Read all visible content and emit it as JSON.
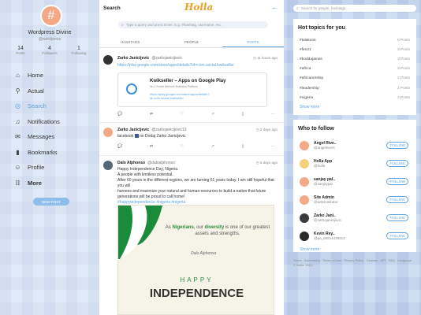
{
  "profile": {
    "name": "Wordpress Divine",
    "handle": "@wordpress",
    "stats": [
      {
        "n": "14",
        "l": "Posts"
      },
      {
        "n": "4",
        "l": "Followers"
      },
      {
        "n": "1",
        "l": "Following"
      }
    ]
  },
  "nav": [
    {
      "label": "Home",
      "icon": "home-icon"
    },
    {
      "label": "Actual",
      "icon": "pin-icon"
    },
    {
      "label": "Search",
      "icon": "search-icon"
    },
    {
      "label": "Notifications",
      "icon": "bell-icon"
    },
    {
      "label": "Messages",
      "icon": "envelope-icon"
    },
    {
      "label": "Bookmarks",
      "icon": "bookmark-icon"
    },
    {
      "label": "Profile",
      "icon": "user-icon"
    },
    {
      "label": "More",
      "icon": "grid-icon"
    }
  ],
  "new_post": "NEW POST",
  "main": {
    "title": "Search",
    "logo": "Holla",
    "search_placeholder": "Type a query and press Enter. E.g. #hashtag, username, etc.",
    "tabs": [
      "HASHTAGS",
      "PEOPLE",
      "POSTS"
    ]
  },
  "posts": [
    {
      "name": "Zarko Janicijevic",
      "handle": "@zarkojanicijevic",
      "time": "11 hours ago",
      "link": "https://play.google.com/store/apps/details?id=com.social.kwikseller",
      "card_title": "Kwikseller – Apps on Google Play",
      "card_sub": "No 1 Social Network Business Platform",
      "card_url": "https://play.google.com/store/apps/details?id=com.social.kwikseller"
    },
    {
      "name": "Zarko Janicijevic",
      "handle": "@zarkojanicijevic13",
      "time": "2 days ago",
      "text_before": "facebook",
      "text_after": "on Dodaj Zarko Janicijevic"
    },
    {
      "name": "Dalo Alphonso",
      "handle": "@daloalphonso",
      "time": "5 days ago",
      "lines": [
        "Happy Independence Day, Nigeria.",
        "A people with limitless potential.",
        "After 60 years in the different regions, we are turning 61 years today. I am still hopeful that you will",
        "harness and maximize your natural and human resources to build a nation that future",
        "generations will be proud to call home!",
        "#happyindependence #nigeria #nigeria"
      ]
    }
  ],
  "banner": {
    "quote_before": "As ",
    "quote_bold1": "Nigerians",
    "quote_mid": ", our ",
    "quote_bold2": "diversity",
    "quote_after": " is one of our greatest assets and strengths.",
    "sign": "Dalo Alphonso",
    "happy": "HAPPY",
    "independence": "INDEPENDENCE"
  },
  "right": {
    "search_placeholder": "Search for people, hashtags...",
    "hot_title": "Hot topics for you",
    "hot_topics": [
      {
        "tag": "#talakons",
        "count": "5 Posts"
      },
      {
        "tag": "#fire21",
        "count": "3 Posts"
      },
      {
        "tag": "#boddajames",
        "count": "3 Posts"
      },
      {
        "tag": "#africa",
        "count": "3 Posts"
      },
      {
        "tag": "#africanership",
        "count": "2 Posts"
      },
      {
        "tag": "#leadership",
        "count": "2 Posts"
      },
      {
        "tag": "#nigeria",
        "count": "2 Posts"
      }
    ],
    "show_more": "Show more",
    "who_title": "Who to follow",
    "who": [
      {
        "name": "Angel Rive..",
        "handle": "@angelrivers",
        "color": "#f3a887",
        "glyph": "#"
      },
      {
        "name": "Holla App",
        "handle": "@holla",
        "color": "#f5d27a",
        "glyph": "H"
      },
      {
        "name": "sanjay pal..",
        "handle": "@sanjaypal",
        "color": "#f3a887",
        "glyph": "#"
      },
      {
        "name": "Site Admin",
        "handle": "@administrator",
        "color": "#f3a887",
        "glyph": "#"
      },
      {
        "name": "Zarko Jani..",
        "handle": "@zarkojanicijevic",
        "color": "#3a3a3a",
        "glyph": ""
      },
      {
        "name": "Kevin Rey..",
        "handle": "@pa_92614439313",
        "color": "#2a2a2a",
        "glyph": ""
      }
    ],
    "follow_label": "FOLLOW",
    "footer": "Home · Advertising · Terms of Use · Privacy Policy · Cookies · API · FAQ · Language · © Holla. 2021."
  }
}
